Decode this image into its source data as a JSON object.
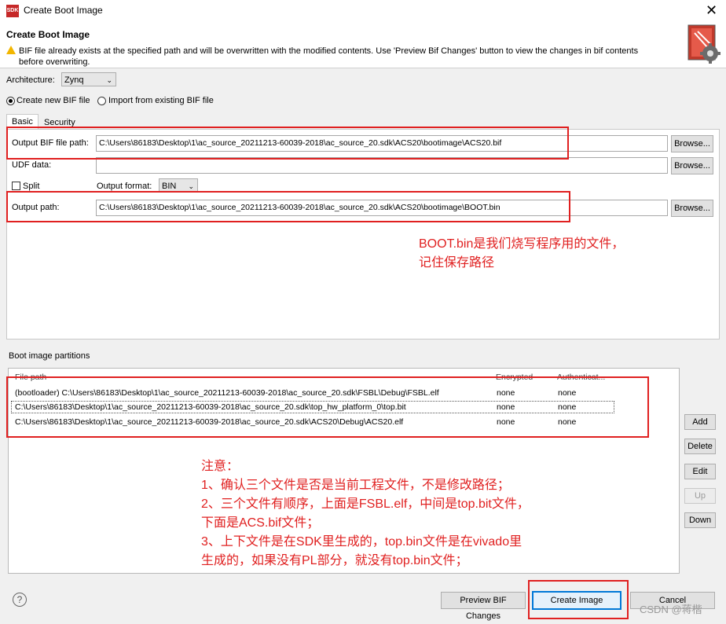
{
  "window": {
    "title": "Create Boot Image",
    "app_icon_text": "SDK",
    "close_glyph": "✕"
  },
  "header": {
    "title": "Create Boot Image",
    "warning_line1": "BIF file already exists at the specified path and will be overwritten with the modified contents. Use 'Preview Bif Changes' button to view the changes in bif contents",
    "warning_line2": "before overwriting."
  },
  "architecture": {
    "label": "Architecture:",
    "value": "Zynq"
  },
  "bif_mode": {
    "create_label": "Create new BIF file",
    "import_label": "Import from existing BIF file",
    "selected": "create"
  },
  "tabs": {
    "basic": "Basic",
    "security": "Security"
  },
  "form": {
    "output_bif_label": "Output BIF file path:",
    "output_bif_value": "C:\\Users\\86183\\Desktop\\1\\ac_source_20211213-60039-2018\\ac_source_20.sdk\\ACS20\\bootimage\\ACS20.bif",
    "udf_label": "UDF data:",
    "udf_value": "",
    "split_label": "Split",
    "output_format_label": "Output format:",
    "output_format_value": "BIN",
    "output_path_label": "Output path:",
    "output_path_value": "C:\\Users\\86183\\Desktop\\1\\ac_source_20211213-60039-2018\\ac_source_20.sdk\\ACS20\\bootimage\\BOOT.bin",
    "browse_label": "Browse..."
  },
  "partitions": {
    "section_label": "Boot image partitions",
    "columns": [
      "File path",
      "Encrypted",
      "Authenticat..."
    ],
    "rows": [
      {
        "path": "(bootloader) C:\\Users\\86183\\Desktop\\1\\ac_source_20211213-60039-2018\\ac_source_20.sdk\\FSBL\\Debug\\FSBL.elf",
        "encrypted": "none",
        "auth": "none"
      },
      {
        "path": "C:\\Users\\86183\\Desktop\\1\\ac_source_20211213-60039-2018\\ac_source_20.sdk\\top_hw_platform_0\\top.bit",
        "encrypted": "none",
        "auth": "none"
      },
      {
        "path": "C:\\Users\\86183\\Desktop\\1\\ac_source_20211213-60039-2018\\ac_source_20.sdk\\ACS20\\Debug\\ACS20.elf",
        "encrypted": "none",
        "auth": "none"
      }
    ]
  },
  "side_buttons": {
    "add": "Add",
    "delete": "Delete",
    "edit": "Edit",
    "up": "Up",
    "down": "Down"
  },
  "footer": {
    "help_glyph": "?",
    "preview_label": "Preview BIF Changes",
    "create_label": "Create Image",
    "cancel_label": "Cancel"
  },
  "annotations": {
    "boot_note_line1": "BOOT.bin是我们烧写程序用的文件，",
    "boot_note_line2": "记住保存路径",
    "notes": [
      "注意：",
      "1、确认三个文件是否是当前工程文件，不是修改路径；",
      "2、三个文件有顺序，上面是FSBL.elf，中间是top.bit文件，",
      "下面是ACS.bif文件；",
      "3、上下文件是在SDK里生成的，top.bin文件是在vivado里",
      "生成的，如果没有PL部分，就没有top.bin文件；"
    ],
    "color": "#e02020"
  },
  "watermark": "CSDN @蒋楷"
}
